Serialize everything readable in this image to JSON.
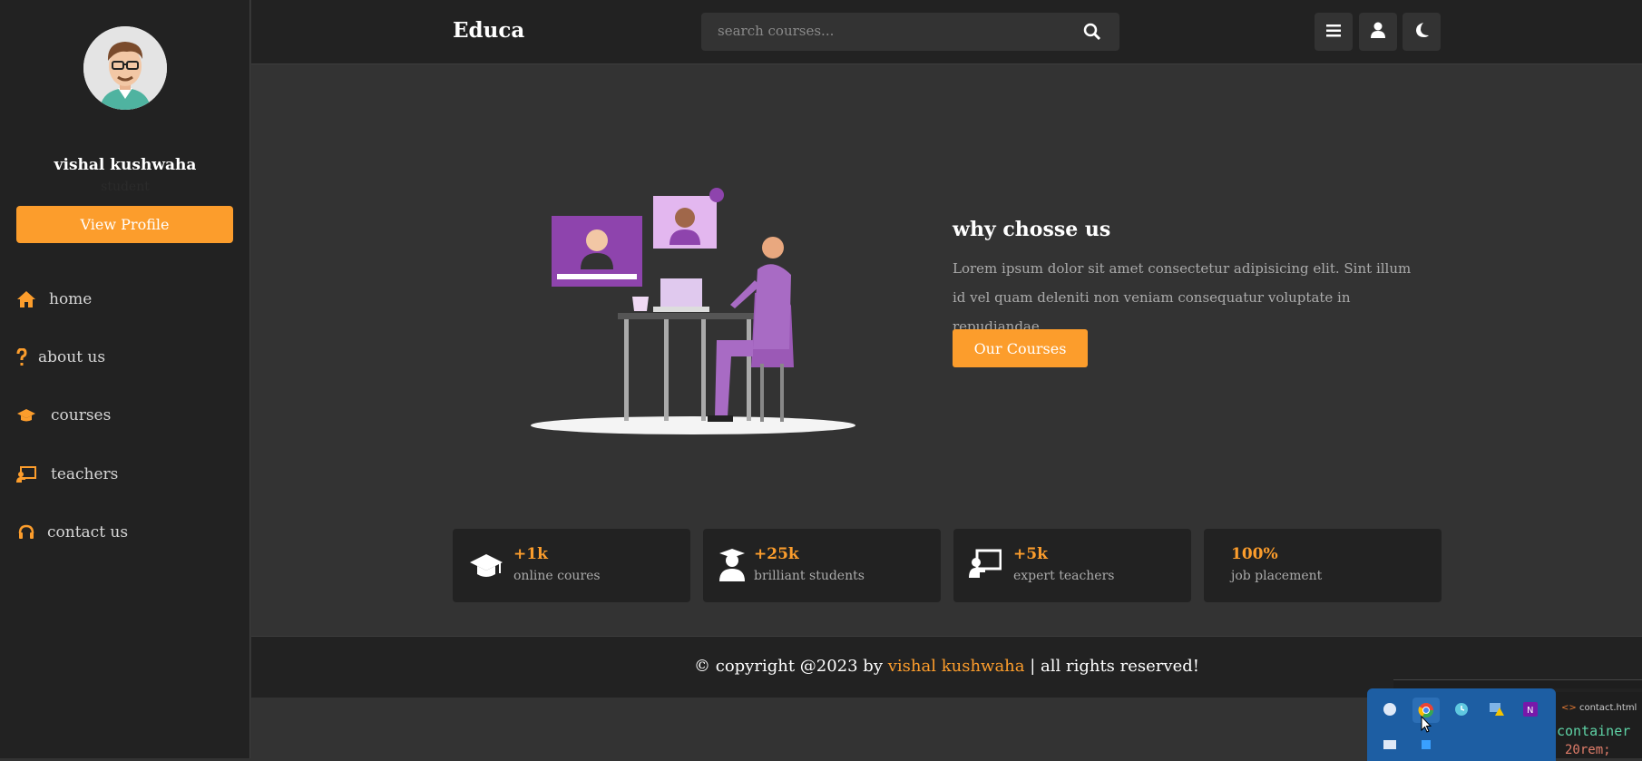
{
  "sidebar": {
    "user_name": "vishal kushwaha",
    "user_role": "student",
    "profile_button": "View Profile",
    "nav": [
      {
        "label": "home",
        "icon": "home-icon"
      },
      {
        "label": "about us",
        "icon": "question-icon"
      },
      {
        "label": "courses",
        "icon": "graduation-cap-icon"
      },
      {
        "label": "teachers",
        "icon": "chalkboard-teacher-icon"
      },
      {
        "label": "contact us",
        "icon": "headset-icon"
      }
    ]
  },
  "header": {
    "logo": "Educa",
    "search_placeholder": "search courses...",
    "buttons": [
      "menu-icon",
      "user-icon",
      "moon-icon"
    ]
  },
  "hero": {
    "title": "why chosse us",
    "text": "Lorem ipsum dolor sit amet consectetur adipisicing elit. Sint illum id vel quam deleniti non veniam consequatur voluptate in repudiandae.",
    "button": "Our Courses"
  },
  "stats": [
    {
      "value": "+1k",
      "label": "online coures",
      "icon": "graduation-cap-icon"
    },
    {
      "value": "+25k",
      "label": "brilliant students",
      "icon": "user-graduate-icon"
    },
    {
      "value": "+5k",
      "label": "expert teachers",
      "icon": "chalkboard-teacher-icon"
    },
    {
      "value": "100%",
      "label": "job placement",
      "icon": ""
    }
  ],
  "footer": {
    "prefix": "© copyright @2023 by ",
    "author": "vishal kushwaha",
    "suffix": " | all rights reserved!"
  },
  "editor": {
    "tab": "contact.html",
    "line1": "container",
    "line2": "20rem;"
  },
  "colors": {
    "accent": "#fc9d2c",
    "background": "#333333",
    "panel": "#222222"
  }
}
